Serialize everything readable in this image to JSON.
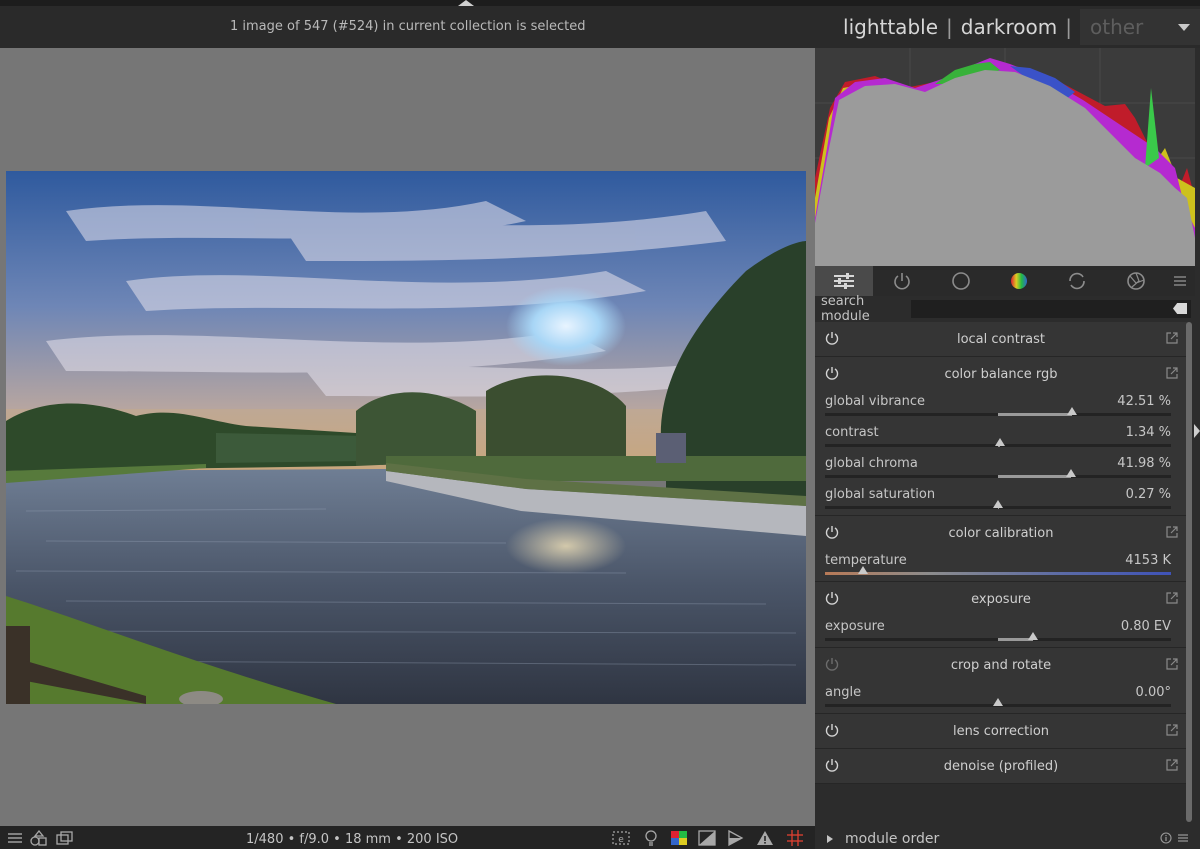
{
  "header": {
    "status": "1 image of 547 (#524) in current collection is selected",
    "views": {
      "lighttable": "lighttable",
      "darkroom": "darkroom",
      "other": "other",
      "separator": "|"
    }
  },
  "right_panel": {
    "tabs": [
      {
        "icon": "sliders-icon",
        "active": true
      },
      {
        "icon": "power-icon",
        "active": false
      },
      {
        "icon": "circle-icon",
        "active": false
      },
      {
        "icon": "color-sphere-icon",
        "active": false
      },
      {
        "icon": "refresh-icon",
        "active": false
      },
      {
        "icon": "aperture-icon",
        "active": false
      },
      {
        "icon": "menu-icon",
        "active": false
      }
    ],
    "search": {
      "label": "search module",
      "value": ""
    },
    "modules": [
      {
        "title": "local contrast",
        "enabled": true,
        "sliders": []
      },
      {
        "title": "color balance rgb",
        "enabled": true,
        "sliders": [
          {
            "label": "global vibrance",
            "value": "42.51 %",
            "level": 0.4251,
            "from_center": true
          },
          {
            "label": "contrast",
            "value": "1.34 %",
            "level": 0.0134,
            "from_center": true
          },
          {
            "label": "global chroma",
            "value": "41.98 %",
            "level": 0.4198,
            "from_center": true
          },
          {
            "label": "global saturation",
            "value": "0.27 %",
            "level": 0.0027,
            "from_center": true
          }
        ]
      },
      {
        "title": "color calibration",
        "enabled": true,
        "sliders": [
          {
            "label": "temperature",
            "value": "4153 K",
            "level": 0.11,
            "temperature": true
          }
        ]
      },
      {
        "title": "exposure",
        "enabled": true,
        "sliders": [
          {
            "label": "exposure",
            "value": "0.80 EV",
            "level": 0.2,
            "from_center": true
          }
        ]
      },
      {
        "title": "crop and rotate",
        "enabled": false,
        "sliders": [
          {
            "label": "angle",
            "value": "0.00°",
            "level": 0.0,
            "from_center": true
          }
        ]
      },
      {
        "title": "lens correction",
        "enabled": true,
        "sliders": []
      },
      {
        "title": "denoise (profiled)",
        "enabled": true,
        "sliders": []
      }
    ],
    "module_order": "module order"
  },
  "bottom": {
    "exif": "1/480 • f/9.0 • 18 mm • 200 ISO",
    "left_icons": [
      "menu-icon",
      "styles-icon",
      "snapshot-icon"
    ],
    "right_icons": [
      "focus-peaking-icon",
      "bulb-icon",
      "color-assessment-icon",
      "softproof-icon",
      "gamut-check-icon",
      "warning-icon",
      "guides-icon"
    ]
  },
  "colors": {
    "workspace": "#767676",
    "panel": "#2c2c2c",
    "module_bg": "#353535",
    "accent_grid": "#e04030"
  }
}
